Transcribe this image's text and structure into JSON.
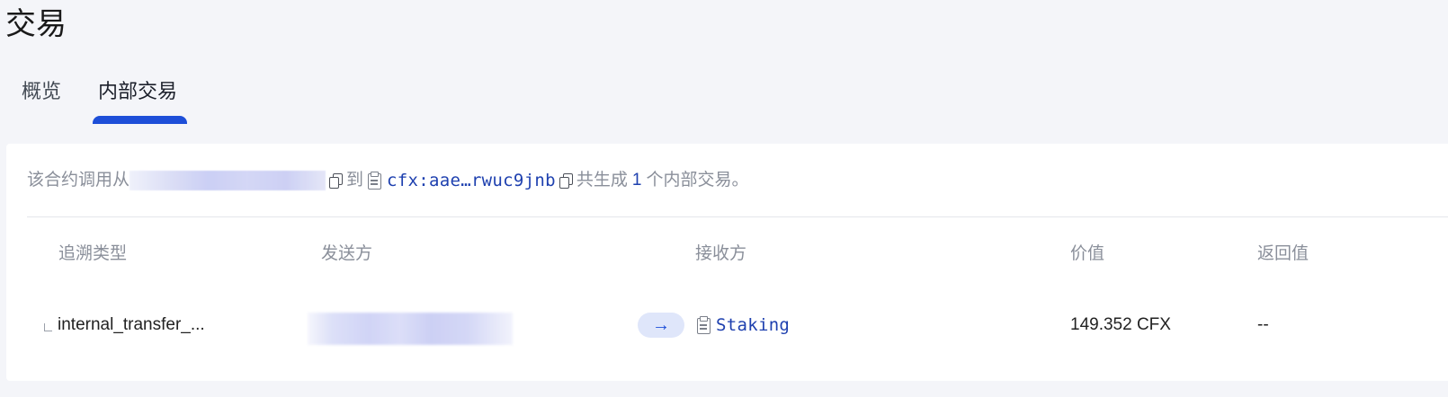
{
  "page": {
    "title": "交易"
  },
  "tabs": [
    {
      "label": "概览",
      "active": false
    },
    {
      "label": "内部交易",
      "active": true
    }
  ],
  "summary": {
    "prefix": "该合约调用从",
    "to_word": "到",
    "to_address": "cfx:aae…rwuc9jnb",
    "generated_prefix": "共生成",
    "count": "1",
    "generated_suffix": "个内部交易。"
  },
  "table": {
    "headers": [
      "追溯类型",
      "发送方",
      "接收方",
      "价值",
      "返回值"
    ],
    "rows": [
      {
        "trace_type": "internal_transfer_...",
        "receiver": "Staking",
        "value": "149.352 CFX",
        "return_value": "--"
      }
    ]
  },
  "colors": {
    "accent": "#1d4ed8",
    "link": "#1e40af",
    "muted_text": "#8a8f9a",
    "background": "#f4f5f9"
  },
  "icons": [
    "copy-icon",
    "contract-icon",
    "arrow-right-icon",
    "tree-branch-icon"
  ]
}
